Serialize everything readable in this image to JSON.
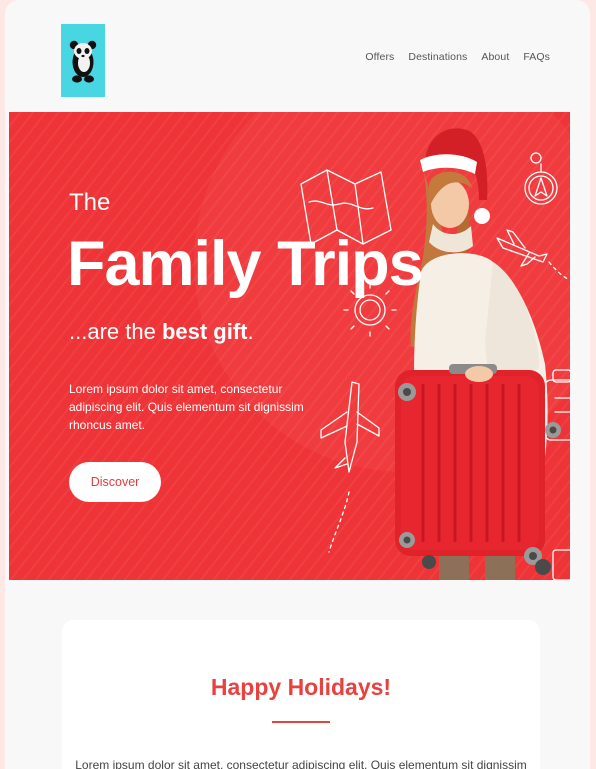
{
  "header": {
    "logo_icon": "panda-icon",
    "logo_bg": "#49d6e3",
    "nav": [
      {
        "label": "Offers"
      },
      {
        "label": "Destinations"
      },
      {
        "label": "About"
      },
      {
        "label": "FAQs"
      }
    ]
  },
  "hero": {
    "pre_title": "The",
    "title": "Family Trips",
    "subtitle_prefix": "...are the ",
    "subtitle_bold": "best gift",
    "subtitle_suffix": ".",
    "description": "Lorem ipsum dolor sit amet, consectetur adipiscing elit. Quis elementum sit dignissim rhoncus amet.",
    "cta_label": "Discover",
    "background_color": "#ee3437",
    "illustrations": [
      "map-icon",
      "compass-icon",
      "airplane-icon",
      "sun-icon",
      "suitcase-icon",
      "woman-with-suitcase-photo"
    ]
  },
  "card": {
    "title": "Happy Holidays!",
    "text": "Lorem ipsum dolor sit amet, consectetur adipiscing elit. Quis elementum sit dignissim",
    "accent_color": "#e8413f"
  }
}
